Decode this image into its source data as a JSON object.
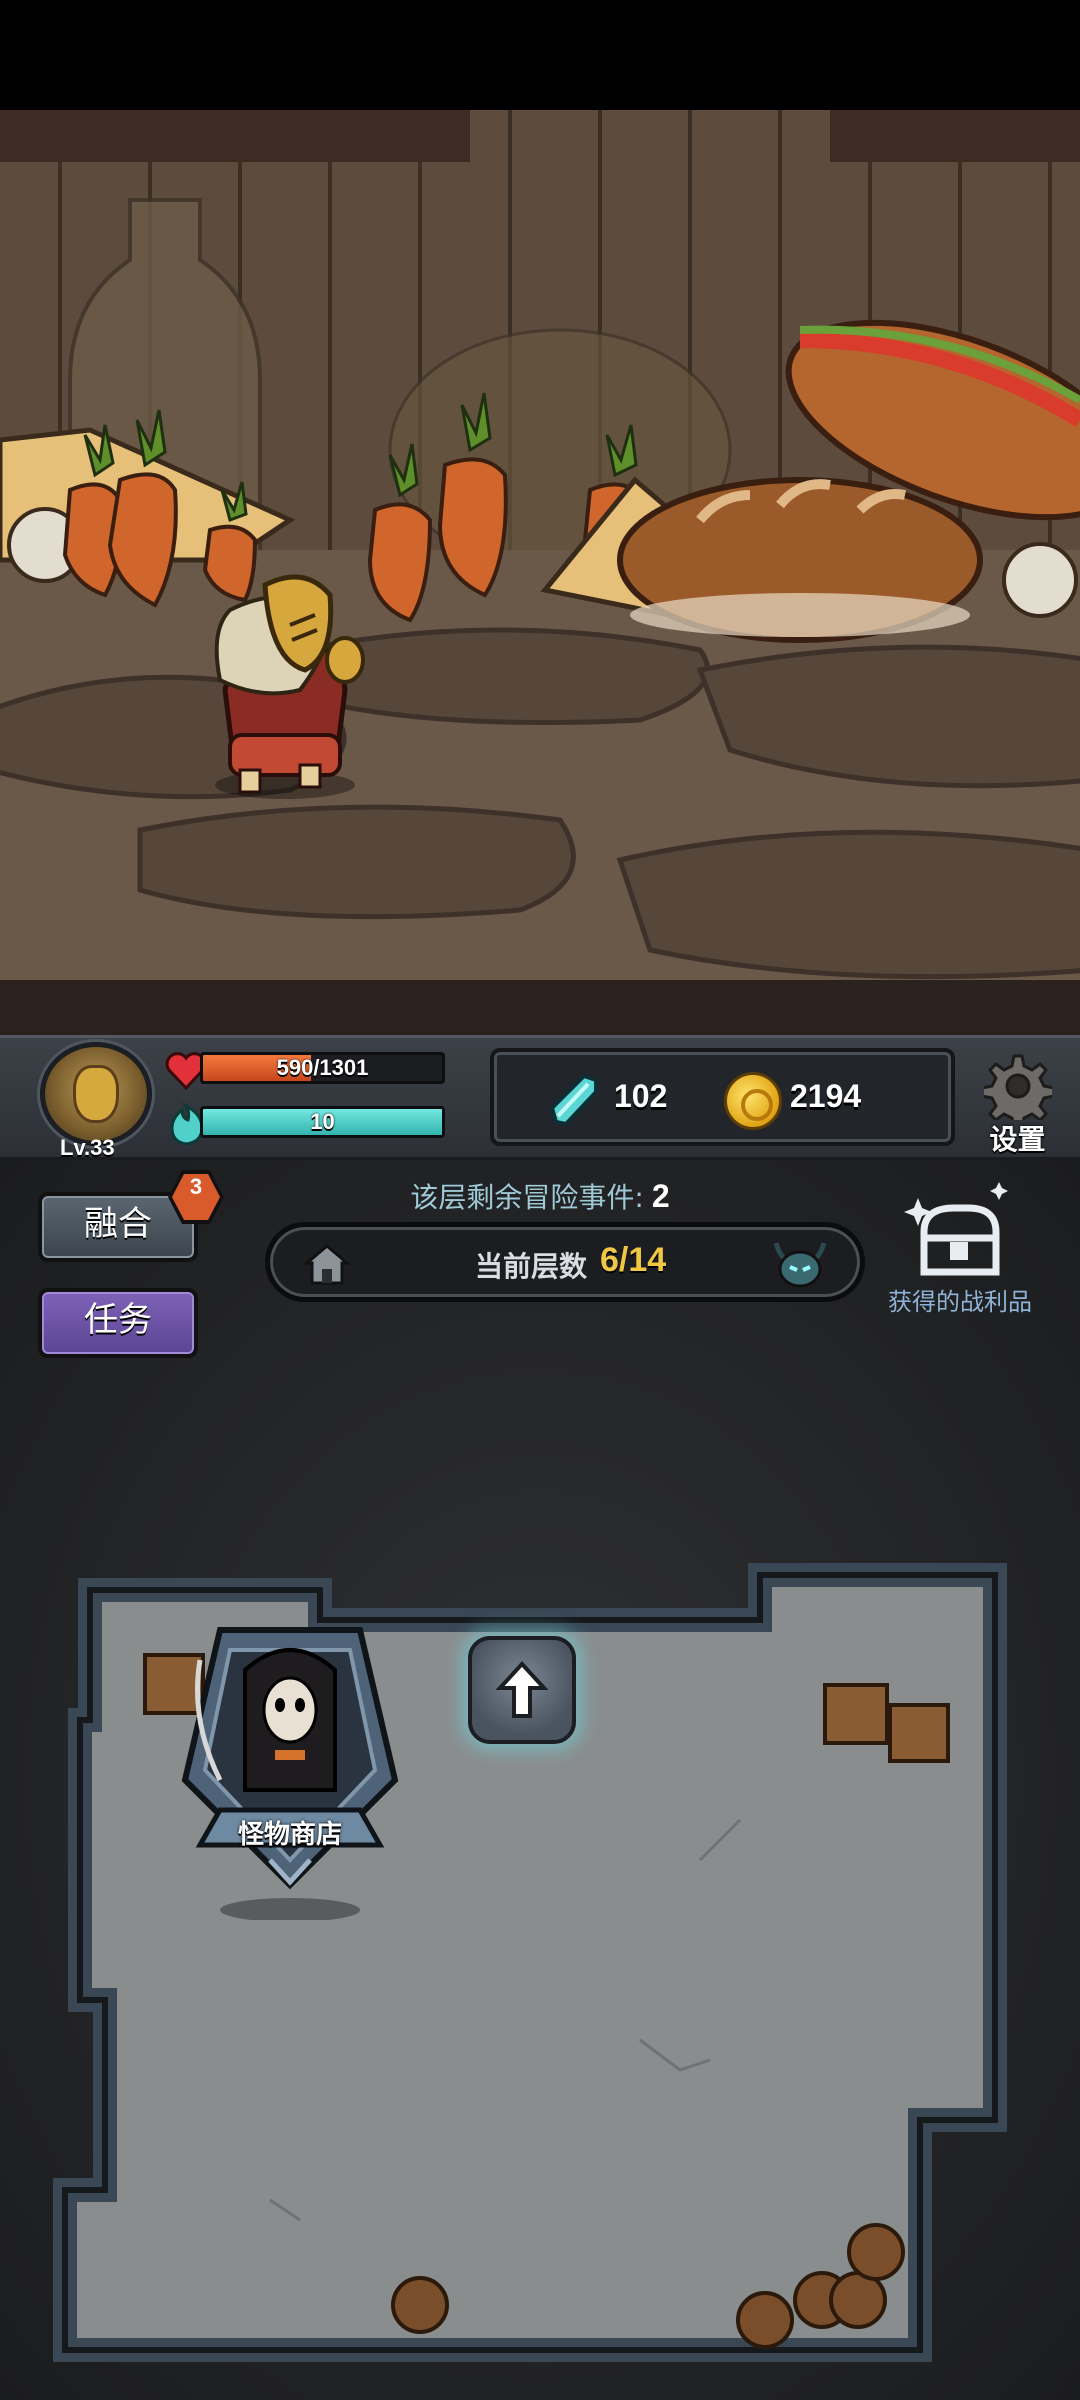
{
  "player": {
    "level": "Lv.33",
    "hp": {
      "text": "590/1301",
      "current": 590,
      "max": 1301
    },
    "mp": {
      "text": "10",
      "fraction": 1.0
    }
  },
  "resources": {
    "gems": "102",
    "coins": "2194"
  },
  "settings": {
    "label": "设置"
  },
  "side_buttons": {
    "fusion": {
      "label": "融合",
      "badge": "3"
    },
    "task": {
      "label": "任务"
    }
  },
  "floor": {
    "remaining_label": "该层剩余冒险事件:",
    "remaining_value": "2",
    "current_label": "当前层数",
    "current_value": "6/14"
  },
  "loot": {
    "label": "获得的战利品"
  },
  "room": {
    "shop_label": "怪物商店"
  },
  "colors": {
    "hp": "#e0602c",
    "mp": "#4fd0c8",
    "floor_value": "#f0c843",
    "task_button": "#6a52a4",
    "remain_text": "#9fc9d6"
  },
  "icons": {
    "hp": "heart-icon",
    "mp": "flame-icon",
    "gem": "crystal-icon",
    "coin": "coin-icon",
    "settings": "gear-icon",
    "home": "house-icon",
    "boss": "demon-head-icon",
    "loot": "treasure-chest-icon",
    "up": "arrow-up-icon"
  }
}
